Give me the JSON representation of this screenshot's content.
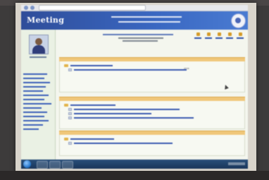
{
  "site": {
    "logo_text": "Meeting",
    "header_title_line1": "",
    "header_title_line2": ""
  },
  "browser": {
    "address": ""
  },
  "sidebar": {
    "user_name": "",
    "items": [
      "",
      "",
      "",
      "",
      "",
      "",
      "",
      "",
      "",
      "",
      "",
      "",
      "",
      ""
    ]
  },
  "main": {
    "meeting_title": "",
    "meeting_date_line": "",
    "meeting_place_line": "",
    "year_text": "2556",
    "toolbar": {
      "icons": [
        "home-icon",
        "print-icon",
        "search-icon",
        "help-icon",
        "logout-icon"
      ],
      "labels": [
        "",
        "",
        "",
        "",
        ""
      ]
    },
    "sections": [
      {
        "title": "",
        "items": [
          {
            "label": ""
          },
          {
            "label": ""
          }
        ]
      },
      {
        "title": "",
        "items": [
          {
            "label": ""
          },
          {
            "label": ""
          },
          {
            "label": ""
          },
          {
            "label": ""
          }
        ]
      },
      {
        "title": "",
        "items": [
          {
            "label": ""
          },
          {
            "label": ""
          }
        ]
      }
    ]
  },
  "colors": {
    "header_blue": "#3a68c2",
    "section_orange": "#f0c77a",
    "link_blue": "#2c4fa8",
    "taskbar": "#19365a"
  }
}
